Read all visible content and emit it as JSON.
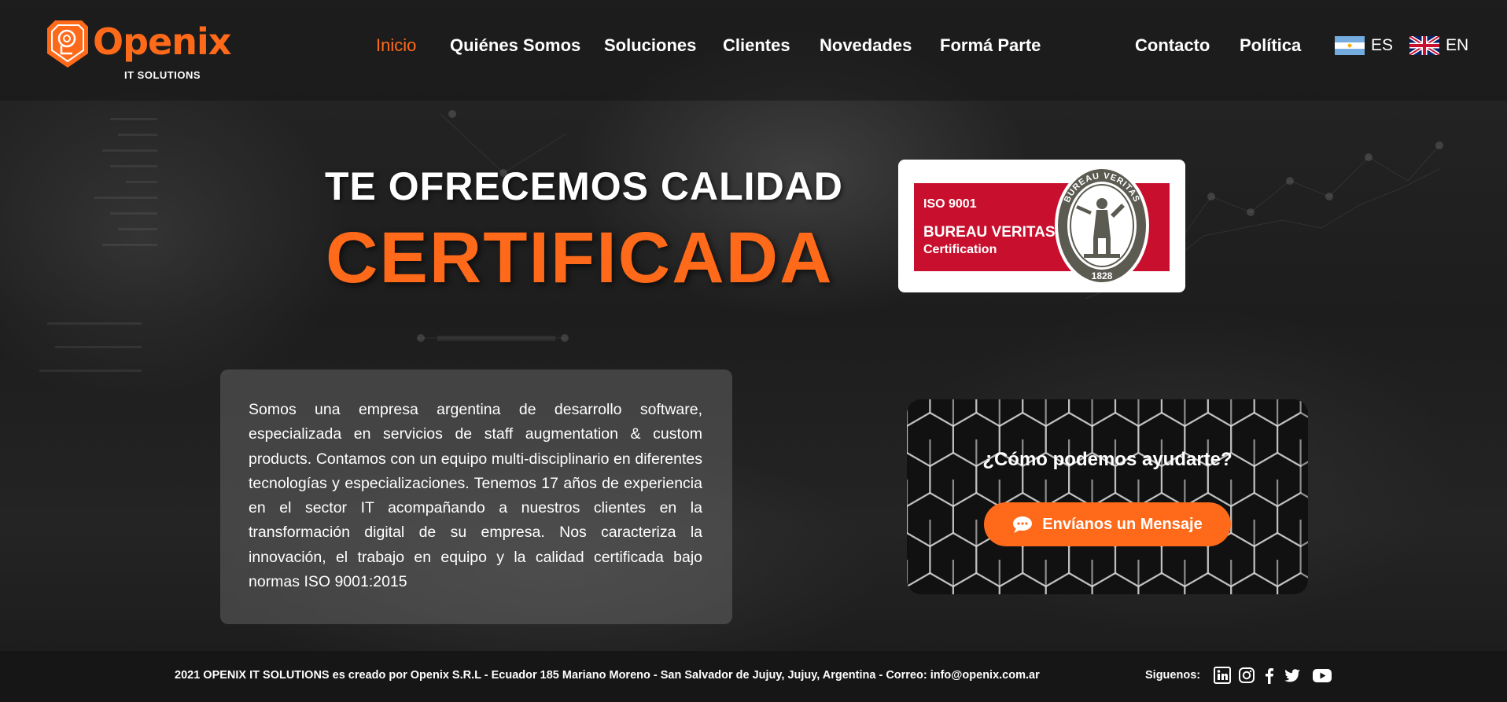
{
  "brand": {
    "name": "Openix",
    "tagline": "IT SOLUTIONS",
    "accent": "#ff6a1a"
  },
  "nav": {
    "items": [
      {
        "label": "Inicio",
        "active": true
      },
      {
        "label": "Quiénes Somos"
      },
      {
        "label": "Soluciones"
      },
      {
        "label": "Clientes"
      },
      {
        "label": "Novedades"
      },
      {
        "label": "Formá Parte"
      },
      {
        "label": "Contacto"
      },
      {
        "label": "Política"
      }
    ],
    "languages": [
      {
        "code": "ES",
        "icon": "argentina-flag-icon"
      },
      {
        "code": "EN",
        "icon": "uk-flag-icon"
      }
    ]
  },
  "hero": {
    "line1": "TE OFRECEMOS CALIDAD",
    "line2": "CERTIFICADA"
  },
  "badge": {
    "iso": "ISO 9001",
    "org": "BUREAU VERITAS",
    "kind": "Certification",
    "seal_text": "BUREAU VERITAS",
    "seal_year": "1828",
    "color": "#c8102e"
  },
  "description": "Somos una empresa argentina de desarrollo software, especializada en servicios de staff augmentation & custom products. Contamos con un equipo multi-disciplinario en diferentes tecnologías y especializaciones. Tenemos 17 años de experiencia en el sector IT acompañando a nuestros clientes en la transformación digital de su empresa. Nos caracteriza la innovación, el trabajo en equipo y la calidad certificada bajo normas ISO 9001:2015",
  "help": {
    "question": "¿Cómo podemos ayudarte?",
    "button": "Envíanos un Mensaje",
    "button_icon": "chat-bubble-icon"
  },
  "footer": {
    "text": "2021 OPENIX IT SOLUTIONS es creado por Openix S.R.L - Ecuador 185 Mariano Moreno - San Salvador de Jujuy, Jujuy, Argentina - Correo: info@openix.com.ar",
    "follow_label": "Siguenos:",
    "social": [
      "linkedin-icon",
      "instagram-icon",
      "facebook-icon",
      "twitter-icon",
      "youtube-icon"
    ]
  }
}
